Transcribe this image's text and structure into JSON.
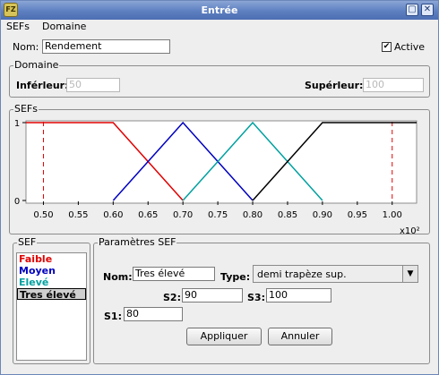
{
  "window": {
    "title": "Entrée"
  },
  "menu": {
    "items": [
      "SEFs",
      "Domaine"
    ]
  },
  "name_row": {
    "label": "Nom:",
    "value": "Rendement",
    "active_label": "Active",
    "active_checked": true
  },
  "domain": {
    "title": "Domaine",
    "lower_label": "Inférleur:",
    "lower_value": "50",
    "upper_label": "Supérleur:",
    "upper_value": "100"
  },
  "sefs_panel": {
    "title": "SEFs"
  },
  "chart_data": {
    "type": "line",
    "x_tick_labels": [
      "0.50",
      "0.55",
      "0.60",
      "0.65",
      "0.70",
      "0.75",
      "0.80",
      "0.85",
      "0.90",
      "0.95",
      "1.00"
    ],
    "x_scale_note": "x10²",
    "y_tick_labels": [
      "1",
      "0"
    ],
    "xlim": [
      0.475,
      1.035
    ],
    "ylim": [
      0,
      1
    ],
    "bounds_markers": [
      0.5,
      1.0
    ],
    "series": [
      {
        "name": "Faible",
        "color": "#e00000",
        "x": [
          0.475,
          0.6,
          0.7
        ],
        "y": [
          1,
          1,
          0
        ]
      },
      {
        "name": "Moyen",
        "color": "#0000c0",
        "x": [
          0.6,
          0.7,
          0.8
        ],
        "y": [
          0,
          1,
          0
        ]
      },
      {
        "name": "Elevé",
        "color": "#00a0a0",
        "x": [
          0.7,
          0.8,
          0.9
        ],
        "y": [
          0,
          1,
          0
        ]
      },
      {
        "name": "Tres élevé",
        "color": "#000000",
        "x": [
          0.8,
          0.9,
          1.035
        ],
        "y": [
          0,
          1,
          1
        ]
      }
    ]
  },
  "sef_list": {
    "title": "SEF",
    "items": [
      {
        "label": "Faible",
        "color": "#e00000"
      },
      {
        "label": "Moyen",
        "color": "#0000c0"
      },
      {
        "label": "Elevé",
        "color": "#00a0a0"
      },
      {
        "label": "Tres élevé",
        "color": "#000000"
      }
    ]
  },
  "params": {
    "title": "Paramètres SEF",
    "name_label": "Nom:",
    "name_value": "Tres élevé",
    "type_label": "Type:",
    "type_value": "demi trapèze sup.",
    "s2_label": "S2:",
    "s2_value": "90",
    "s3_label": "S3:",
    "s3_value": "100",
    "s1_label": "S1:",
    "s1_value": "80",
    "apply_label": "Appliquer",
    "cancel_label": "Annuler"
  }
}
